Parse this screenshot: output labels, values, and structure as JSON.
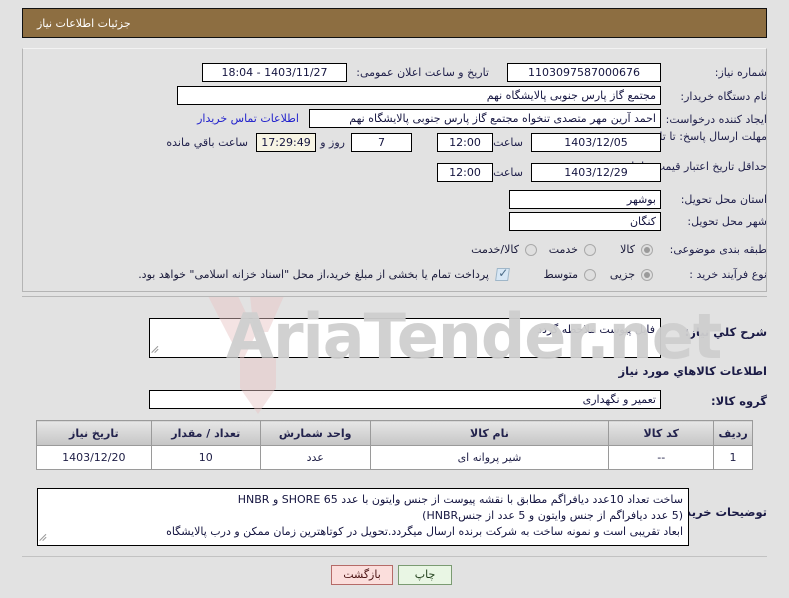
{
  "window": {
    "title": "جزئیات اطلاعات نیاز"
  },
  "watermark": {
    "text": "AriaTender.net"
  },
  "form": {
    "need_number_label": "شماره نیاز:",
    "need_number_value": "1103097587000676",
    "announce_datetime_label": "تاریخ و ساعت اعلان عمومی:",
    "announce_datetime_value": "1403/11/27 - 18:04",
    "buyer_org_label": "نام دستگاه خریدار:",
    "buyer_org_value": "مجتمع گاز پارس جنوبی  پالایشگاه نهم",
    "requester_label": "ایجاد کننده درخواست:",
    "requester_value": "احمد آرین مهر متصدی تنخواه مجتمع گاز پارس جنوبی  پالایشگاه نهم",
    "contact_link": "اطلاعات تماس خریدار",
    "deadline_label": "مهلت ارسال پاسخ: تا تاریخ:",
    "deadline_date": "1403/12/05",
    "hour_label": "ساعت",
    "deadline_time": "12:00",
    "days_remaining": "7",
    "days_and_label": "روز و",
    "time_remaining": "17:29:49",
    "remaining_label": "ساعت باقي مانده",
    "price_validity_label": "حداقل تاریخ اعتبار قیمت: تا تاریخ:",
    "price_validity_date": "1403/12/29",
    "price_validity_hour_label": "ساعت",
    "price_validity_time": "12:00",
    "province_label": "استان محل تحویل:",
    "province_value": "بوشهر",
    "city_label": "شهر محل تحویل:",
    "city_value": "کنگان",
    "classification_label": "طبقه بندی موضوعی:",
    "classification_options": [
      {
        "label": "کالا",
        "selected": true
      },
      {
        "label": "خدمت",
        "selected": false
      },
      {
        "label": "کالا/خدمت",
        "selected": false
      }
    ],
    "process_type_label": "نوع فرآیند خرید :",
    "process_type_options": [
      {
        "label": "جزیی",
        "selected": true
      },
      {
        "label": "متوسط",
        "selected": false
      }
    ],
    "treasury_checkbox_checked": true,
    "treasury_note": "پرداخت تمام یا بخشی از مبلغ خرید،از محل \"اسناد خزانه اسلامی\" خواهد بود."
  },
  "description": {
    "general_label": "شرح کلي نیاز:",
    "general_value": "فایل پیوست ملاحظه گردد",
    "goods_section_title": "اطلاعات کالاهاي مورد نیاز",
    "group_label": "گروه کالا:",
    "group_value": "تعمیر و نگهداری",
    "buyer_notes_label": "توضیحات خریدار:",
    "buyer_notes_lines": [
      "ساخت تعداد 10عدد دیافراگم مطابق با نقشه پیوست از جنس وایتون با عدد SHORE 65 و HNBR",
      "(5 عدد دیافراگم از جنس وایتون و 5 عدد از جنسHNBR)",
      "ابعاد تقریبی است و نمونه ساخت به شرکت برنده ارسال میگردد.تحویل در کوتاهترین زمان ممکن و درب پالایشگاه"
    ]
  },
  "goods_table": {
    "headers": [
      "ردیف",
      "کد کالا",
      "نام کالا",
      "واحد شمارش",
      "تعداد / مقدار",
      "تاریخ نیاز"
    ],
    "rows": [
      {
        "radif": "1",
        "code": "--",
        "name": "شیر پروانه ای",
        "unit": "عدد",
        "quantity": "10",
        "need_date": "1403/12/20"
      }
    ]
  },
  "footer": {
    "print_label": "چاپ",
    "back_label": "بازگشت"
  }
}
